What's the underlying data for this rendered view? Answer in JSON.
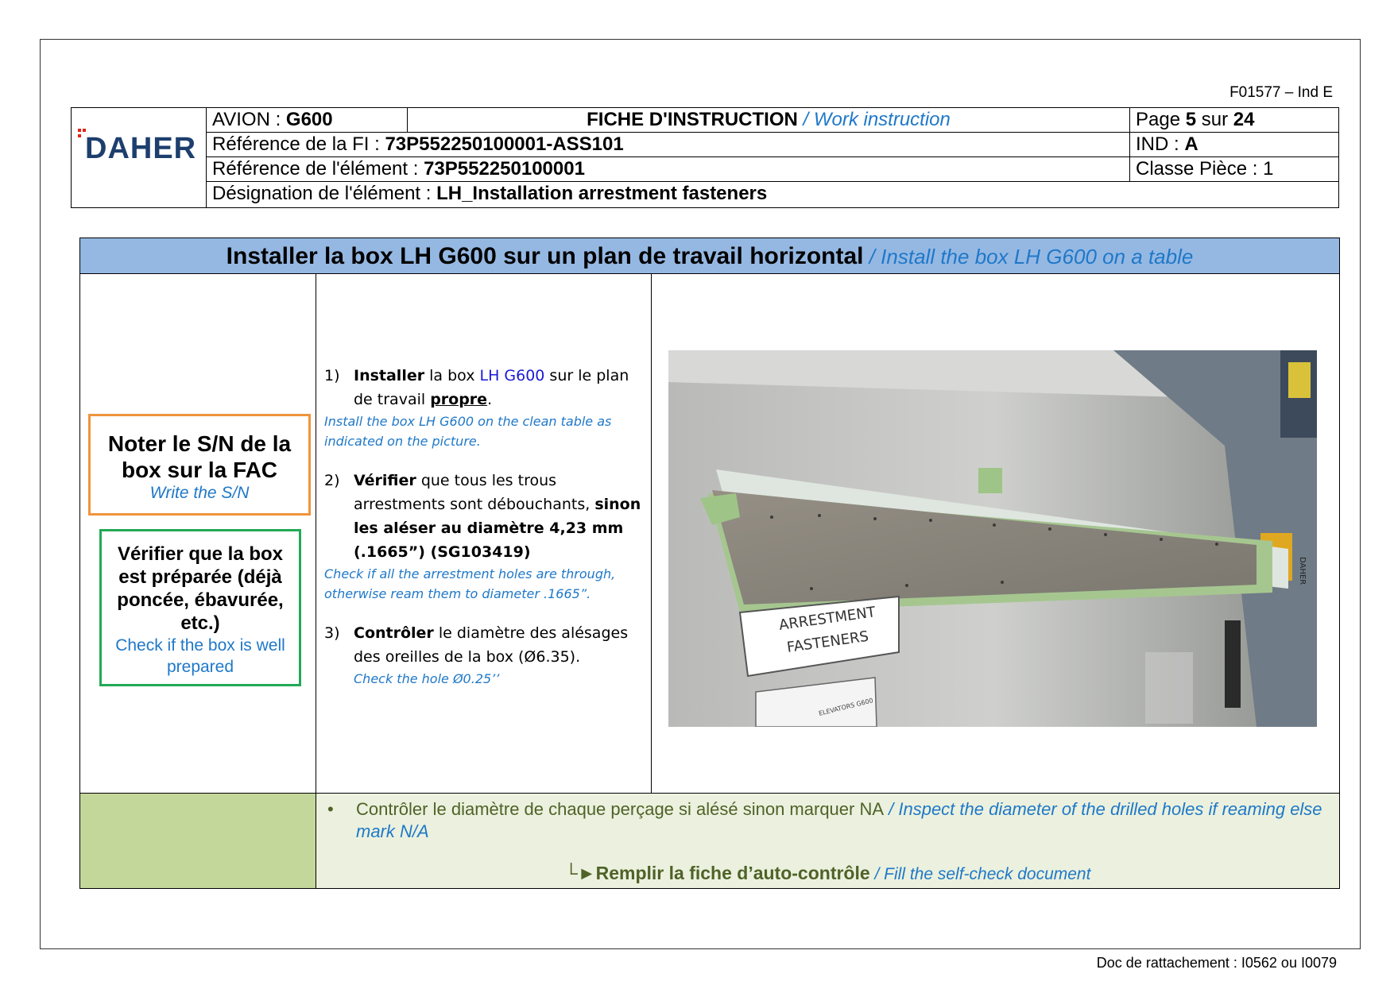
{
  "doc_code": "F01577 – Ind E",
  "header": {
    "logo_text": "DAHER",
    "avion_label": "AVION : ",
    "avion_value": "G600",
    "fiche_title": "FICHE D'INSTRUCTION",
    "fiche_title_en": " / Work instruction",
    "page_label": "Page ",
    "page_num": "5",
    "page_sur": " sur ",
    "page_total": "24",
    "ref_fi_label": "Référence de la FI : ",
    "ref_fi_value": "73P552250100001-ASS101",
    "ind_label": "IND : ",
    "ind_value": "A",
    "ref_elem_label": "Référence de l'élément : ",
    "ref_elem_value": "73P552250100001",
    "classe_label": "Classe Pièce : 1",
    "designation_label": "Désignation de l'élément : ",
    "designation_value": "LH_Installation arrestment fasteners"
  },
  "section": {
    "title_fr": "Installer la box LH G600 sur un plan de travail horizontal",
    "title_en": " / Install the box LH G600 on a table"
  },
  "notes": {
    "orange_title": "Noter le S/N de la box sur la FAC",
    "orange_sub": "Write the S/N",
    "green_title": "Vérifier que la box est préparée (déjà poncée, ébavurée, etc.)",
    "green_sub": "Check if the box is well prepared"
  },
  "steps": [
    {
      "num": "1)",
      "bold": "Installer",
      "t1": " la box ",
      "blue": "LH G600",
      "t2": " sur le plan de travail ",
      "underline": "propre",
      "t3": ".",
      "en": "Install the box LH G600 on the clean table as indicated on the picture."
    },
    {
      "num": "2)",
      "bold": "Vérifier",
      "t1": " que tous les trous arrestments sont débouchants, ",
      "bold2": "sinon les aléser au diamètre 4,23 mm (.1665”) (SG103419)",
      "en": "Check if all the arrestment holes are through, otherwise ream them to diameter .1665”."
    },
    {
      "num": "3)",
      "bold": "Contrôler",
      "t1": " le diamètre des alésages des oreilles de la box (Ø6.35).",
      "en": "Check the hole Ø0.25’’"
    }
  ],
  "photo": {
    "label_line1": "ARRESTMENT",
    "label_line2": "FASTENERS",
    "label_small": "ELEVATORS G600",
    "side_sign": "DAHER"
  },
  "footer": {
    "bullet_fr": "Contrôler le diamètre de chaque perçage si alésé sinon marquer NA",
    "bullet_en": " / Inspect the diameter of the drilled holes if reaming else mark N/A",
    "fill_arrow": "└►",
    "fill_fr": "Remplir la fiche d’auto-contrôle",
    "fill_en": " / Fill the self-check document"
  },
  "bottom_ref": "Doc de rattachement : I0562 ou I0079",
  "colors": {
    "title_bar": "#95b8e3",
    "orange_box": "#f0943c",
    "green_box": "#22a955",
    "footer_left": "#c4d79b",
    "footer_right": "#ebf1de",
    "english_text": "#1f78c8"
  }
}
